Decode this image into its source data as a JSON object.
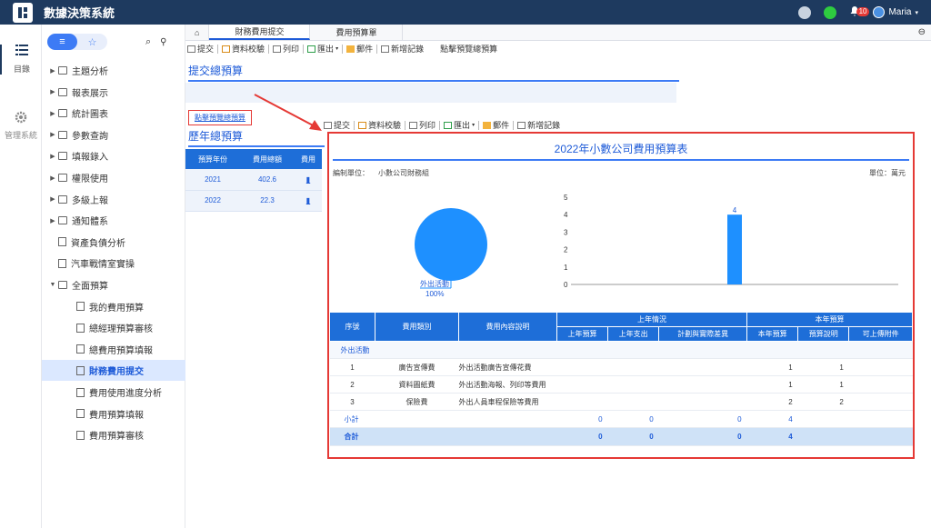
{
  "app": {
    "title": "數據決策系統"
  },
  "topbar": {
    "notif_count": "10",
    "user_name": "Maria"
  },
  "rail": {
    "catalog": "目錄",
    "admin": "管理系統"
  },
  "sidebar": {
    "items": [
      {
        "label": "主題分析",
        "type": "folder"
      },
      {
        "label": "報表展示",
        "type": "folder"
      },
      {
        "label": "統計圖表",
        "type": "folder"
      },
      {
        "label": "參數查詢",
        "type": "folder"
      },
      {
        "label": "填報錄入",
        "type": "folder"
      },
      {
        "label": "權限使用",
        "type": "folder"
      },
      {
        "label": "多級上報",
        "type": "folder"
      },
      {
        "label": "通知體系",
        "type": "folder"
      },
      {
        "label": "資產負債分析",
        "type": "doc"
      },
      {
        "label": "汽車戰情室實操",
        "type": "doc"
      },
      {
        "label": "全面預算",
        "type": "folder-open"
      },
      {
        "label": "我的費用預算",
        "type": "doc-child"
      },
      {
        "label": "總經理預算審核",
        "type": "doc-child"
      },
      {
        "label": "總費用預算填報",
        "type": "doc-child"
      },
      {
        "label": "財務費用提交",
        "type": "doc-child-active"
      },
      {
        "label": "費用使用進度分析",
        "type": "doc-child"
      },
      {
        "label": "費用預算填報",
        "type": "doc-child"
      },
      {
        "label": "費用預算審核",
        "type": "doc-child"
      }
    ]
  },
  "tabs": [
    {
      "label": "財務費用提交"
    },
    {
      "label": "費用預算單"
    }
  ],
  "toolbar": {
    "submit": "提交",
    "verify": "資料校驗",
    "print": "列印",
    "export": "匯出",
    "mail": "郵件",
    "add": "新增記錄",
    "hint": "點擊預覽總預算"
  },
  "submit_section": {
    "title": "提交總預算",
    "link": "點擊預覽總預算"
  },
  "history_section": {
    "title": "歷年總預算",
    "headers": [
      "預算年份",
      "費用總額",
      "費用"
    ],
    "rows": [
      {
        "year": "2021",
        "total": "402.6"
      },
      {
        "year": "2022",
        "total": "22.3"
      }
    ]
  },
  "report": {
    "title": "2022年小數公司費用預算表",
    "org_label": "編制單位：",
    "org_value": "小數公司財務組",
    "unit": "單位：萬元",
    "pie_label": "外出活動",
    "pie_pct": "100%",
    "headers_top": [
      "序號",
      "費用類別",
      "費用內容說明",
      "上年情況",
      "本年預算"
    ],
    "headers_sub": [
      "上年預算",
      "上年支出",
      "計劃與實際差異",
      "本年預算",
      "預算說明",
      "可上傳附件"
    ],
    "group": "外出活動",
    "rows": [
      {
        "no": "1",
        "cat": "廣告宣傳費",
        "desc": "外出活動廣告宣傳花費",
        "budget": "1",
        "attach": "1"
      },
      {
        "no": "2",
        "cat": "資料圖紙費",
        "desc": "外出活動海報、列印等費用",
        "budget": "1",
        "attach": "1"
      },
      {
        "no": "3",
        "cat": "保險費",
        "desc": "外出人員車程保險等費用",
        "budget": "2",
        "attach": "2"
      }
    ],
    "subtotal": {
      "label": "小計",
      "a": "0",
      "b": "0",
      "c": "0",
      "d": "4"
    },
    "total": {
      "label": "合計",
      "a": "0",
      "b": "0",
      "c": "0",
      "d": "4"
    }
  },
  "chart_data": {
    "type": "bar",
    "categories": [
      "外出活動"
    ],
    "values": [
      4
    ],
    "ylim": [
      0,
      5
    ],
    "yticks": [
      0,
      1,
      2,
      3,
      4,
      5
    ]
  },
  "colors": {
    "accent": "#3d7bf5",
    "header": "#1e6ed8",
    "topbar": "#1e3a5f",
    "highlight": "#e53935"
  }
}
